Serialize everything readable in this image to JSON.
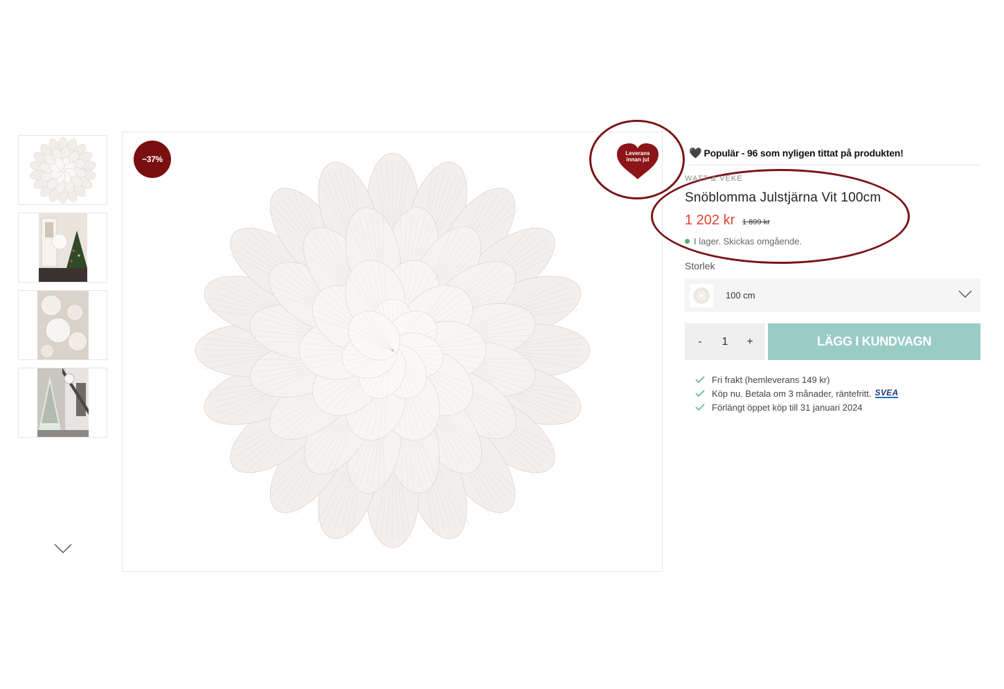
{
  "gallery": {
    "thumbnails": [
      "thumb-flower-star",
      "thumb-hallway-christmas-tree",
      "thumb-white-stars-cluster",
      "thumb-staircase-christmas-tree"
    ],
    "next_icon": "chevron-down-icon"
  },
  "main_image": {
    "discount_badge": "−37%",
    "delivery_badge": {
      "line1": "Leverans",
      "line2": "innan jul",
      "color": "#8b1518"
    }
  },
  "product": {
    "popular_icon": "black-heart-icon",
    "popular_text": "Populär - 96 som nyligen tittat på produkten!",
    "brand": "WATT & VEKE",
    "title": "Snöblomma Julstjärna Vit 100cm",
    "price": "1 202 kr",
    "old_price": "1 899 kr",
    "stock": "I lager. Skickas omgående.",
    "size_label": "Storlek",
    "size_value": "100 cm",
    "quantity": "1",
    "qty_minus": "-",
    "qty_plus": "+",
    "add_to_cart": "LÄGG I KUNDVAGN",
    "usps": [
      "Fri frakt (hemleverans 149 kr)",
      "Köp nu. Betala om 3 månader, räntefritt.",
      "Förlängt öppet köp till 31 januari 2024"
    ],
    "svea_logo": "SVEA"
  },
  "colors": {
    "price": "#e0432f",
    "discount_badge": "#7a0f10",
    "cart_button": "#99ccc5",
    "annotation": "#7a1416",
    "check": "#5cb88a"
  }
}
